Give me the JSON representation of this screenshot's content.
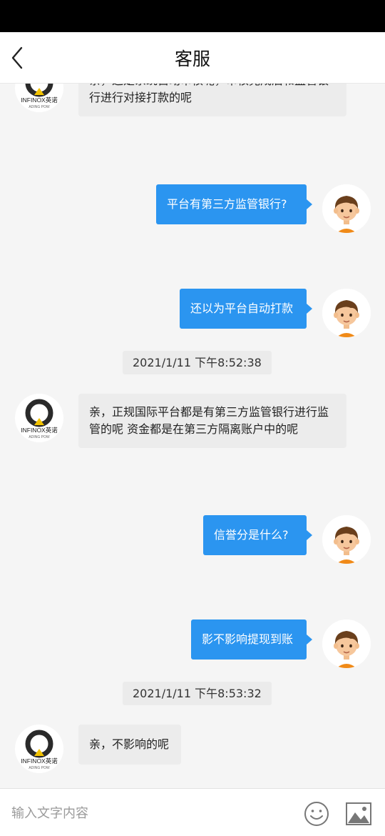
{
  "header": {
    "title": "客服",
    "back_icon": "chevron-left-icon"
  },
  "messages": [
    {
      "side": "in",
      "text": "亲，这是系统自动审核呢，审核完成后和监管银行进行对接打款的呢"
    },
    {
      "side": "out",
      "text": "平台有第三方监管银行?"
    },
    {
      "side": "out",
      "text": "还以为平台自动打款"
    },
    {
      "side": "time",
      "text": "2021/1/11 下午8:52:38"
    },
    {
      "side": "in",
      "text": "亲，正规国际平台都是有第三方监管银行进行监管的呢 资金都是在第三方隔离账户中的呢"
    },
    {
      "side": "out",
      "text": "信誉分是什么?"
    },
    {
      "side": "out",
      "text": "影不影响提现到账"
    },
    {
      "side": "time",
      "text": "2021/1/11 下午8:53:32"
    },
    {
      "side": "in",
      "text": "亲，不影响的呢"
    }
  ],
  "agent_avatar": {
    "brand_text": "INFINOX英诺",
    "tagline": "ADING POW"
  },
  "composer": {
    "placeholder": "输入文字内容",
    "emoji_icon": "smiley-icon",
    "image_icon": "picture-icon"
  },
  "colors": {
    "bubble_out": "#2b95f0",
    "bubble_in": "#ececec",
    "brand_yellow": "#f2c200"
  }
}
